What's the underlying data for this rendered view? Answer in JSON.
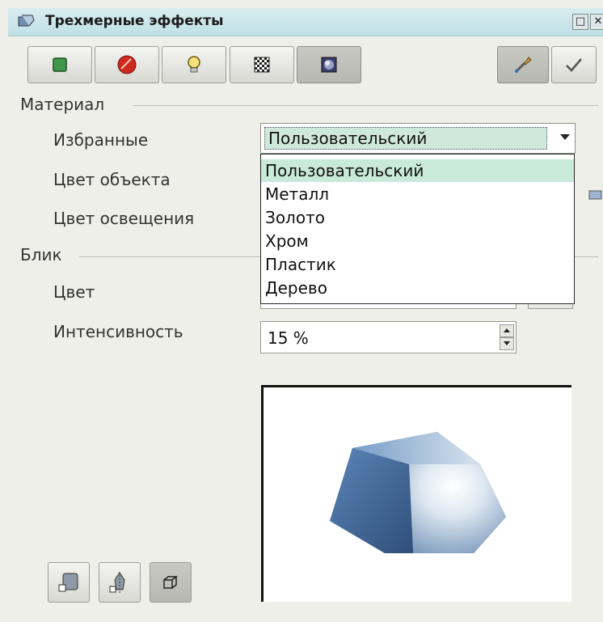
{
  "window": {
    "title": "Трехмерные эффекты",
    "restore_glyph": "□",
    "close_glyph": "✕"
  },
  "toolbar": {
    "buttons": [
      {
        "icon": "geometry-icon",
        "selected": false
      },
      {
        "icon": "shading-icon",
        "selected": false
      },
      {
        "icon": "illumination-icon",
        "selected": false
      },
      {
        "icon": "textures-icon",
        "selected": false
      },
      {
        "icon": "material-icon",
        "selected": true
      }
    ],
    "right_buttons": [
      {
        "icon": "pipette-icon",
        "selected": true
      },
      {
        "icon": "assign-checkmark-icon",
        "selected": false
      }
    ]
  },
  "material": {
    "section_label": "Материал",
    "favorites_label": "Избранные",
    "favorites_value": "Пользовательский",
    "object_color_label": "Цвет объекта",
    "illumination_color_label": "Цвет освещения",
    "options": [
      "Пользовательский",
      "Металл",
      "Золото",
      "Хром",
      "Пластик",
      "Дерево"
    ],
    "highlighted_index": 0
  },
  "specular": {
    "section_label": "Блик",
    "color_label": "Цвет",
    "intensity_label": "Интенсивность",
    "intensity_value": "15 %"
  },
  "preview": {
    "shape": "hexagonal-prism",
    "colors": {
      "shade_dark": "#3f6390",
      "shade_light": "#dfe9f2",
      "highlight": "#ffffff"
    }
  },
  "bottom_buttons": [
    {
      "icon": "convert-to-3d-icon",
      "selected": false
    },
    {
      "icon": "lathe-object-icon",
      "selected": false
    },
    {
      "icon": "perspective-icon",
      "selected": true
    }
  ]
}
